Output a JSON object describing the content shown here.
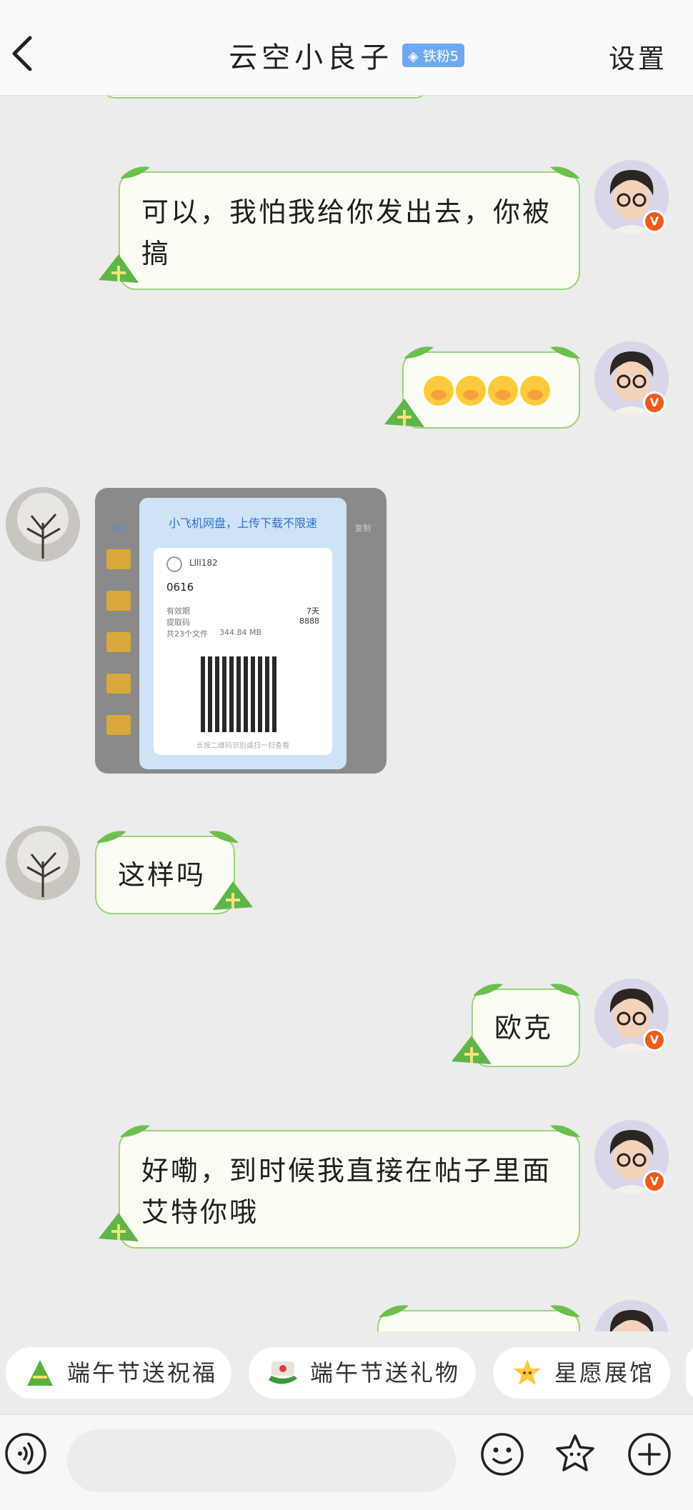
{
  "header": {
    "back_label": "",
    "title": "云空小良子",
    "fan_badge": "◈ 铁粉5",
    "settings_label": "设置"
  },
  "messages": [
    {
      "side": "me",
      "type": "text",
      "text": "可以，我怕我给你发出去，你被搞"
    },
    {
      "side": "me",
      "type": "emoji",
      "count": 4
    },
    {
      "side": "other",
      "type": "image",
      "image": {
        "card_title": "小飞机网盘，上传下载不限速",
        "user": "Llll182",
        "code": "0616",
        "validity_label": "有效期",
        "validity_value": "7天",
        "extract_label": "提取码",
        "extract_value": "8888",
        "files_label": "共23个文件",
        "files_size": "344.84 MB",
        "hint": "长按二维码识别或扫一扫查看",
        "tab_all": "全部",
        "tab_right": "复制"
      }
    },
    {
      "side": "other",
      "type": "text",
      "text": "这样吗"
    },
    {
      "side": "me",
      "type": "text",
      "text": "欧克"
    },
    {
      "side": "me",
      "type": "text",
      "text": "好嘞，到时候我直接在帖子里面艾特你哦"
    }
  ],
  "chips": [
    {
      "label": "端午节送祝福",
      "icon": "zongzi-icon"
    },
    {
      "label": "端午节送礼物",
      "icon": "dragon-boat-icon"
    },
    {
      "label": "星愿展馆",
      "icon": "star-icon"
    }
  ],
  "input": {
    "placeholder": ""
  },
  "colors": {
    "bubble_border": "#9fd27e",
    "bubble_fill": "#fbfdf4",
    "badge_blue": "#6ea8f0",
    "v_badge": "#f05a1a",
    "background": "#ececec"
  }
}
